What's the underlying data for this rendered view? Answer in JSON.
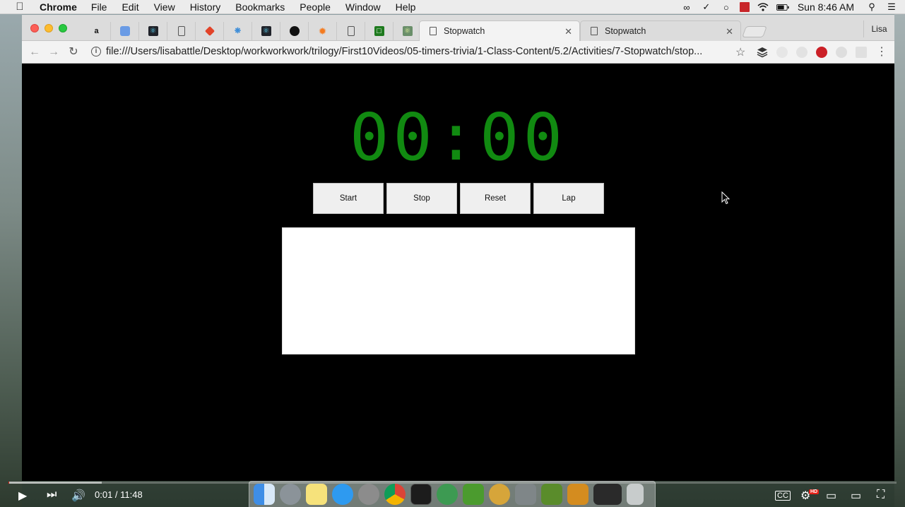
{
  "menubar": {
    "app_name": "Chrome",
    "items": [
      "File",
      "Edit",
      "View",
      "History",
      "Bookmarks",
      "People",
      "Window",
      "Help"
    ],
    "clock": "Sun 8:46 AM"
  },
  "browser": {
    "tabs": [
      {
        "title": "Stopwatch",
        "active": true
      },
      {
        "title": "Stopwatch",
        "active": false
      }
    ],
    "profile": "Lisa",
    "url": "file:///Users/lisabattle/Desktop/workworkwork/trilogy/First10Videos/05-timers-trivia/1-Class-Content/5.2/Activities/7-Stopwatch/stop..."
  },
  "stopwatch": {
    "display": "00:00",
    "buttons": {
      "start": "Start",
      "stop": "Stop",
      "reset": "Reset",
      "lap": "Lap"
    },
    "display_color": "#118a11"
  },
  "player": {
    "time": "0:01 / 11:48",
    "played_fraction": 0.001,
    "accent": "#e62117",
    "quality_badge": "HD"
  }
}
